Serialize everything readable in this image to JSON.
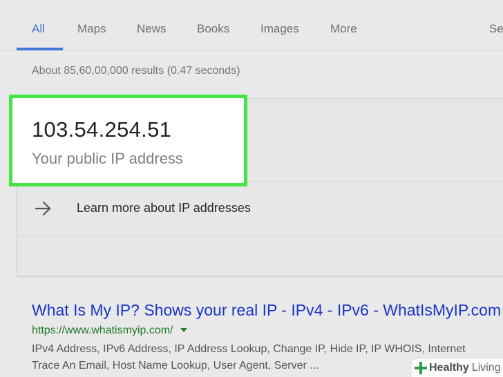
{
  "tabs": [
    {
      "label": "All",
      "active": true
    },
    {
      "label": "Maps",
      "active": false
    },
    {
      "label": "News",
      "active": false
    },
    {
      "label": "Books",
      "active": false
    },
    {
      "label": "Images",
      "active": false
    },
    {
      "label": "More",
      "active": false
    },
    {
      "label": "Se",
      "active": false
    }
  ],
  "results_summary": "About 85,60,00,000 results (0.47 seconds)",
  "ip_card": {
    "ip_address": "103.54.254.51",
    "caption": "Your public IP address",
    "learn_more": "Learn more about IP addresses",
    "arrow_icon": "arrow-right-icon"
  },
  "result": {
    "title": "What Is My IP? Shows your real IP - IPv4 - IPv6 - WhatIsMyIP.com",
    "url": "https://www.whatismyip.com/",
    "snippet_lines": [
      "IPv4 Address, IPv6 Address, IP Address Lookup, Change IP, Hide IP, IP WHOIS, Internet",
      "Trace An Email, Host Name Lookup, User Agent, Server ..."
    ]
  },
  "watermark": {
    "strong": "Healthy",
    "light": "Living"
  },
  "colors": {
    "background": "#e9e9e9",
    "active_tab": "#3c6fd1",
    "highlight_border": "#44e544",
    "link_title": "#1a35c6",
    "url_green": "#1f7a2b"
  }
}
